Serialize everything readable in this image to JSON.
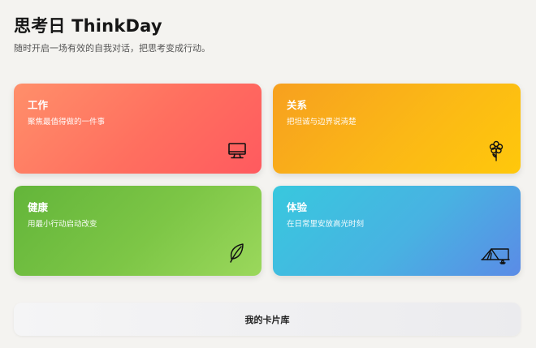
{
  "header": {
    "title": "思考日 ThinkDay",
    "subtitle": "随时开启一场有效的自我对话，把思考变成行动。"
  },
  "cards": [
    {
      "title": "工作",
      "desc": "聚焦最值得做的一件事",
      "icon": "computer-icon",
      "gradient": [
        "#ff8f6a",
        "#ff5a5f"
      ]
    },
    {
      "title": "关系",
      "desc": "把坦诚与边界说清楚",
      "icon": "flower-icon",
      "gradient": [
        "#f7a01f",
        "#ffc80b"
      ]
    },
    {
      "title": "健康",
      "desc": "用最小行动启动改变",
      "icon": "leaf-icon",
      "gradient": [
        "#63b53a",
        "#9bd85c"
      ]
    },
    {
      "title": "体验",
      "desc": "在日常里安放高光时刻",
      "icon": "tent-icon",
      "gradient": [
        "#38c8de",
        "#5b8be6"
      ]
    }
  ],
  "footer": {
    "library_label": "我的卡片库"
  }
}
